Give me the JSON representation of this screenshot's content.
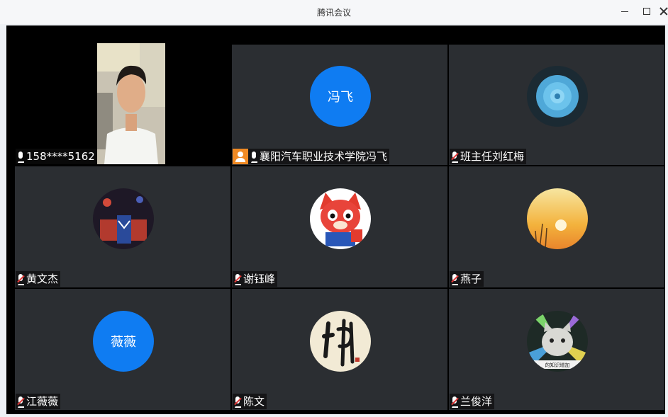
{
  "window": {
    "title": "腾讯会议"
  },
  "participants": [
    {
      "name": "158****5162",
      "mic": "on",
      "kind": "video"
    },
    {
      "name": "襄阳汽车职业技术学院冯飞",
      "mic": "on",
      "kind": "text-avatar",
      "avatar_text": "冯飞",
      "host": true
    },
    {
      "name": "班主任刘红梅",
      "mic": "muted",
      "kind": "image-avatar",
      "avatar_icon": "succulent-photo"
    },
    {
      "name": "黄文杰",
      "mic": "muted",
      "kind": "image-avatar",
      "avatar_icon": "concert-crowd-photo"
    },
    {
      "name": "谢钰峰",
      "mic": "muted",
      "kind": "image-avatar",
      "avatar_icon": "cartoon-fox-photo"
    },
    {
      "name": "燕子",
      "mic": "muted",
      "kind": "image-avatar",
      "avatar_icon": "sunset-photo"
    },
    {
      "name": "江薇薇",
      "mic": "muted",
      "kind": "text-avatar",
      "avatar_text": "薇薇"
    },
    {
      "name": "陈文",
      "mic": "muted",
      "kind": "image-avatar",
      "avatar_icon": "calligraphy-fo-character"
    },
    {
      "name": "兰俊洋",
      "mic": "muted",
      "kind": "image-avatar",
      "avatar_icon": "cat-meme-photo",
      "avatar_caption": "的知识增加"
    }
  ],
  "colors": {
    "tile_bg": "#2b2e32",
    "stage_bg": "#000000",
    "text_avatar_bg": "#0f7cf2",
    "host_badge": "#f08a24",
    "mute_slash": "#e43a3a"
  }
}
